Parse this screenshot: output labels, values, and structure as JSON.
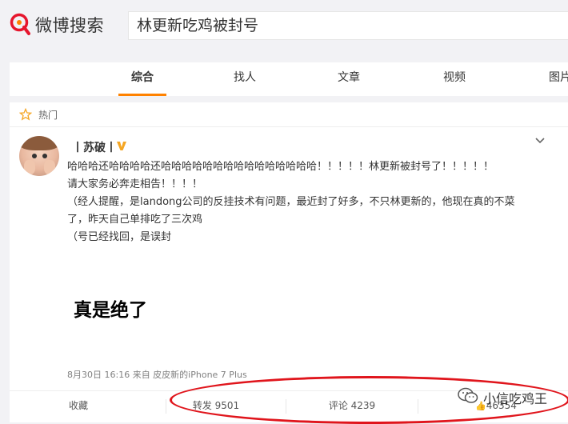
{
  "header": {
    "logo_text": "微博搜索",
    "search_value": "林更新吃鸡被封号"
  },
  "tabs": [
    {
      "label": "综合",
      "active": true
    },
    {
      "label": "找人",
      "active": false
    },
    {
      "label": "文章",
      "active": false
    },
    {
      "label": "视频",
      "active": false
    },
    {
      "label": "图片",
      "active": false
    }
  ],
  "card": {
    "hot_label": "热门",
    "username": "丨苏破丨",
    "post_lines": [
      "哈哈哈还哈哈哈哈还哈哈哈哈哈哈哈哈哈哈哈哈哈哈哈！！！！！林更新被封号了！！！！！",
      "请大家务必奔走相告！！！！",
      "（经人提醒，是landong公司的反挂技术有问题，最近封了好多，不只林更新的，他现在真的不菜",
      "了，昨天自己单排吃了三次鸡",
      "（号已经找回，是误封"
    ],
    "image_text": "真是绝了",
    "meta": "8月30日 16:16 来自 皮皮新的iPhone 7 Plus",
    "actions": {
      "favorite": "收藏",
      "repost": "转发 9501",
      "comment": "评论 4239",
      "like": "46354"
    }
  },
  "watermark": "小信吃鸡王",
  "colors": {
    "accent": "#ff8200",
    "annotation": "#e0151c",
    "verified": "#f5a623"
  }
}
